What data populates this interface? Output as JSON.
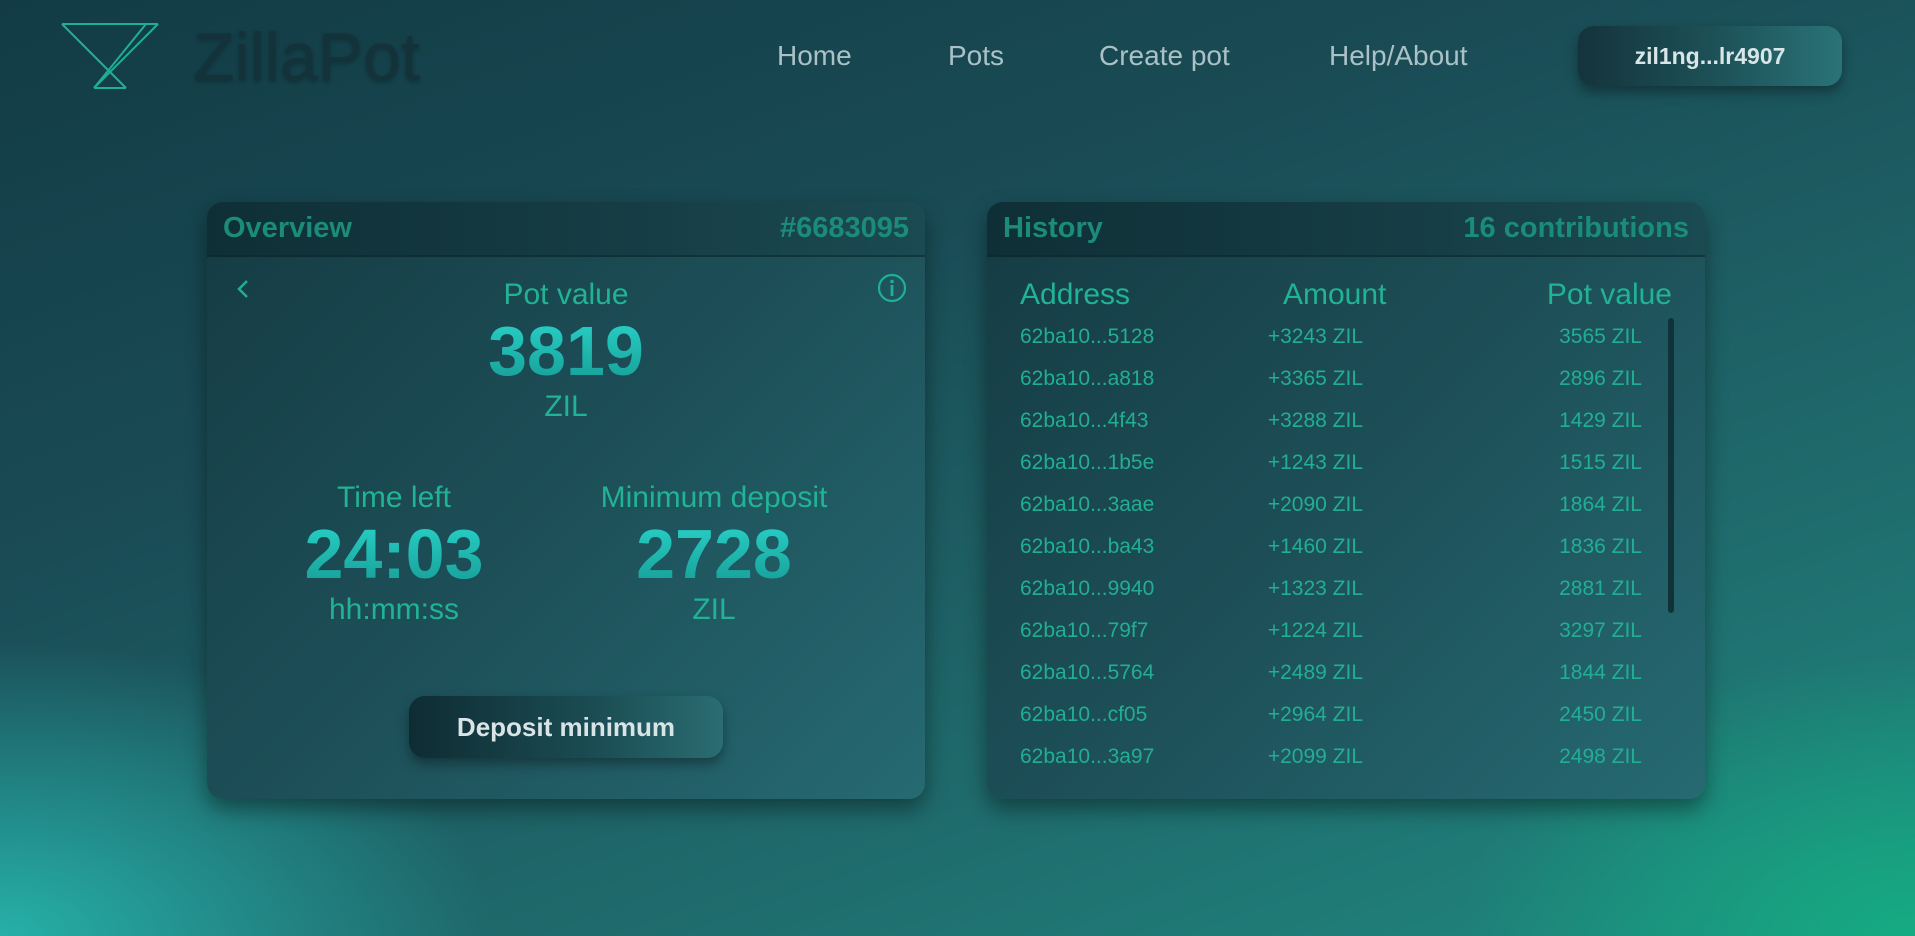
{
  "header": {
    "brand": "ZillaPot",
    "nav": [
      {
        "label": "Home"
      },
      {
        "label": "Pots"
      },
      {
        "label": "Create pot"
      },
      {
        "label": "Help/About"
      }
    ],
    "wallet": "zil1ng...lr4907"
  },
  "overview": {
    "title": "Overview",
    "pot_id": "#6683095",
    "pot_value_label": "Pot value",
    "pot_value": "3819",
    "pot_value_unit": "ZIL",
    "time_left_label": "Time left",
    "time_left": "24:03",
    "time_left_unit": "hh:mm:ss",
    "min_deposit_label": "Minimum deposit",
    "min_deposit": "2728",
    "min_deposit_unit": "ZIL",
    "deposit_button": "Deposit minimum",
    "icons": {
      "back": "chevron-left-icon",
      "info": "info-icon"
    }
  },
  "history": {
    "title": "History",
    "count": "16 contributions",
    "columns": [
      "Address",
      "Amount",
      "Pot value"
    ],
    "rows": [
      {
        "address": "62ba10...5128",
        "amount": "+3243 ZIL",
        "pot": "3565 ZIL"
      },
      {
        "address": "62ba10...a818",
        "amount": "+3365 ZIL",
        "pot": "2896 ZIL"
      },
      {
        "address": "62ba10...4f43",
        "amount": "+3288 ZIL",
        "pot": "1429 ZIL"
      },
      {
        "address": "62ba10...1b5e",
        "amount": "+1243 ZIL",
        "pot": "1515 ZIL"
      },
      {
        "address": "62ba10...3aae",
        "amount": "+2090 ZIL",
        "pot": "1864 ZIL"
      },
      {
        "address": "62ba10...ba43",
        "amount": "+1460 ZIL",
        "pot": "1836 ZIL"
      },
      {
        "address": "62ba10...9940",
        "amount": "+1323 ZIL",
        "pot": "2881 ZIL"
      },
      {
        "address": "62ba10...79f7",
        "amount": "+1224 ZIL",
        "pot": "3297 ZIL"
      },
      {
        "address": "62ba10...5764",
        "amount": "+2489 ZIL",
        "pot": "1844 ZIL"
      },
      {
        "address": "62ba10...cf05",
        "amount": "+2964 ZIL",
        "pot": "2450 ZIL"
      },
      {
        "address": "62ba10...3a97",
        "amount": "+2099 ZIL",
        "pot": "2498 ZIL"
      }
    ]
  },
  "colors": {
    "accent": "#21b396",
    "number_gradient_top": "#2ad5cb",
    "number_gradient_bottom": "#159a93",
    "brand_text": "#14323a"
  }
}
